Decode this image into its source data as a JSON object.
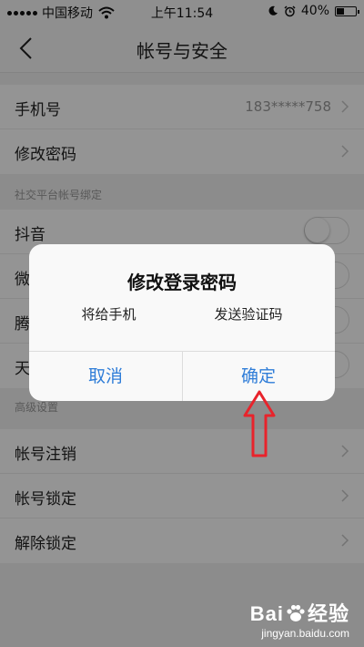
{
  "status_bar": {
    "carrier": "中国移动",
    "time": "上午11:54",
    "battery_text": "40%",
    "battery_level": 0.4,
    "icons": [
      "signal-icon",
      "wifi-icon",
      "moon-icon",
      "alarm-icon",
      "battery-icon"
    ]
  },
  "nav": {
    "title": "帐号与安全",
    "back_icon": "chevron-left-icon"
  },
  "account": {
    "phone_label": "手机号",
    "phone_value": "183*****758",
    "password_label": "修改密码"
  },
  "social": {
    "header": "社交平台帐号绑定",
    "items": [
      {
        "label": "抖音"
      },
      {
        "label": "微"
      },
      {
        "label": "腾"
      },
      {
        "label": "天"
      }
    ]
  },
  "advanced": {
    "header": "高级设置",
    "items": [
      {
        "label": "帐号注销"
      },
      {
        "label": "帐号锁定"
      },
      {
        "label": "解除锁定"
      }
    ]
  },
  "dialog": {
    "title": "修改登录密码",
    "message_prefix": "将给手机",
    "message_suffix": "发送验证码",
    "cancel_label": "取消",
    "confirm_label": "确定"
  },
  "colors": {
    "accent": "#2f7dd8",
    "arrow": "#e8232b",
    "background": "#f2f2f2"
  },
  "watermark": {
    "brand": "Bai",
    "brand_cn": "经验",
    "sub": "jingyan.baidu.com"
  }
}
